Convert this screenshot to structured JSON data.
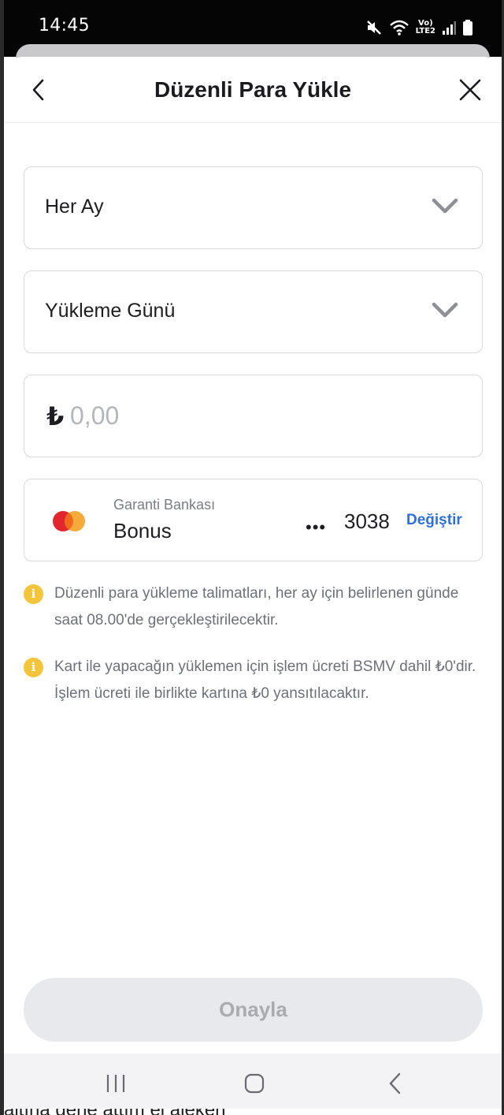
{
  "status_bar": {
    "time": "14:45",
    "network_label_top": "Vo)",
    "network_label_bottom": "LTE2"
  },
  "header": {
    "title": "Düzenli Para Yükle"
  },
  "frequency_select": {
    "value": "Her Ay"
  },
  "day_select": {
    "value": "Yükleme Günü"
  },
  "amount": {
    "currency_symbol": "₺",
    "placeholder": "0,00"
  },
  "card": {
    "bank": "Garanti Bankası",
    "name": "Bonus",
    "masked_prefix": "•••",
    "last_digits": "3038",
    "change_label": "Değiştir"
  },
  "info_notes": [
    {
      "text": "Düzenli para yükleme talimatları, her ay için belirlenen günde saat 08.00'de gerçekleştirilecektir."
    },
    {
      "text": "Kart ile yapacağın yüklemen için işlem ücreti BSMV dahil ₺0'dir. İşlem ücreti ile birlikte kartına ₺0 yansıtılacaktır."
    }
  ],
  "confirm_button": {
    "label": "Onayla"
  },
  "bottom_text": "altına gene attım el aleken",
  "colors": {
    "accent_link": "#2f6fd8",
    "info_icon": "#f4c43a",
    "button_disabled_bg": "#e8e9ec",
    "button_disabled_text": "#a9abb1"
  },
  "icons": {
    "back": "chevron-left-icon",
    "close": "close-icon",
    "dropdown": "chevron-down-icon",
    "info": "info-icon",
    "card_brand": "mastercard-logo"
  }
}
